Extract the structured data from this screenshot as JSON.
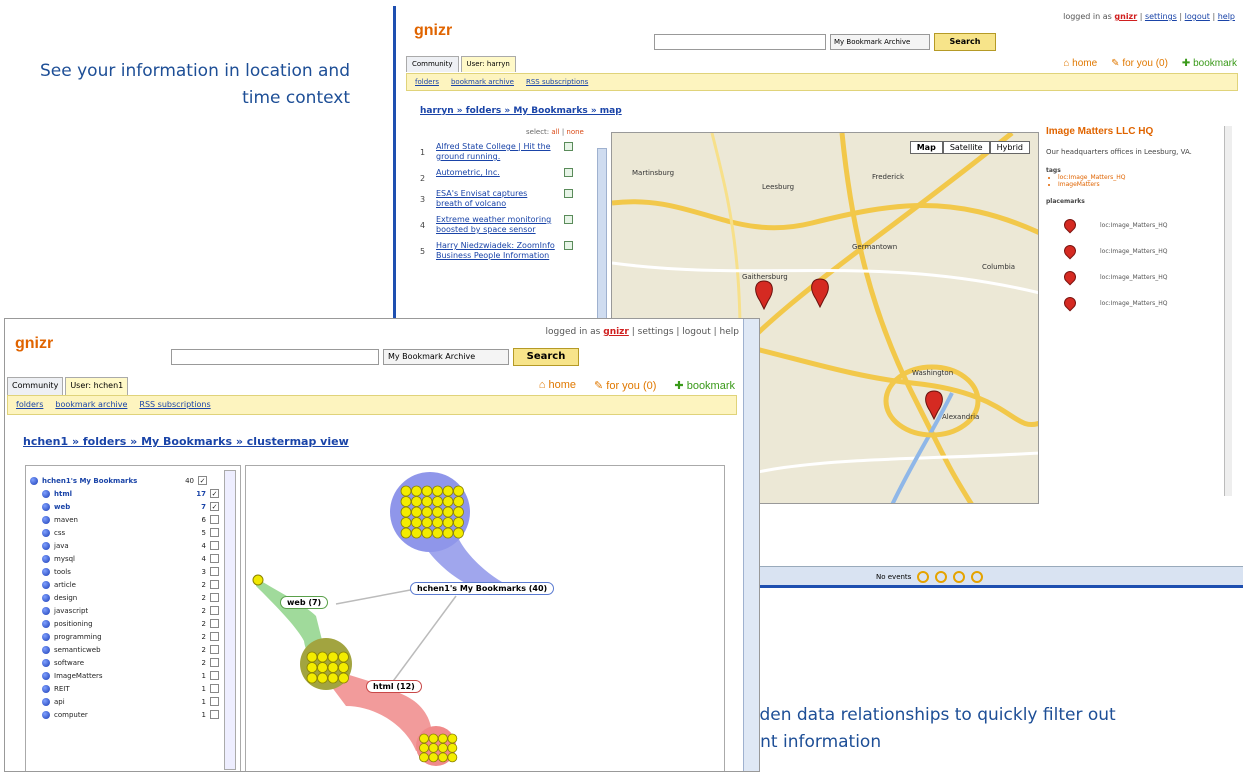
{
  "captions": {
    "top": "See your information in location and time context",
    "bottom": "Use hidden data relationships to quickly filter out irrelevant information"
  },
  "back_window": {
    "logo": "gnizr",
    "logged_in_prefix": "logged in as",
    "user": "gnizr",
    "top_links": [
      "settings",
      "logout",
      "help"
    ],
    "search_placeholder": "",
    "search_scope": "My Bookmark Archive",
    "search_button": "Search",
    "tabs": [
      "Community",
      "User: harryn"
    ],
    "quick_links": [
      "home",
      "for you (0)",
      "bookmark"
    ],
    "subnav": [
      "folders",
      "bookmark archive",
      "RSS subscriptions"
    ],
    "breadcrumb": "harryn » folders » My Bookmarks » map",
    "select_label": "select:",
    "select_all": "all",
    "select_none": "none",
    "bookmarks": [
      {
        "num": "1",
        "title": "Alfred State College | Hit the ground running."
      },
      {
        "num": "2",
        "title": "Autometric, Inc."
      },
      {
        "num": "3",
        "title": "ESA's Envisat captures breath of volcano"
      },
      {
        "num": "4",
        "title": "Extreme weather monitoring boosted by space sensor"
      },
      {
        "num": "5",
        "title": "Harry Niedzwiadek: ZoomInfo Business People Information"
      }
    ],
    "map_buttons": [
      "Map",
      "Satellite",
      "Hybrid"
    ],
    "map_places": [
      "Martinsburg",
      "Leesburg",
      "Gaithersburg",
      "Washington",
      "Alexandria",
      "Frederick",
      "Germantown",
      "Columbia"
    ],
    "info": {
      "title": "Image Matters LLC HQ",
      "description": "Our headquarters offices in Leesburg, VA.",
      "tags_label": "tags",
      "tags": [
        "loc:Image_Matters_HQ",
        "ImageMatters"
      ],
      "placemarks_label": "placemarks",
      "placemarks": [
        "loc:Image_Matters_HQ",
        "loc:Image_Matters_HQ",
        "loc:Image_Matters_HQ",
        "loc:Image_Matters_HQ"
      ]
    },
    "status_text": "No events"
  },
  "front_window": {
    "logo": "gnizr",
    "logged_in_prefix": "logged in as",
    "user": "gnizr",
    "top_links": [
      "settings",
      "logout",
      "help"
    ],
    "search_scope": "My Bookmark Archive",
    "search_button": "Search",
    "tabs": [
      "Community",
      "User: hchen1"
    ],
    "quick_links": [
      "home",
      "for you (0)",
      "bookmark"
    ],
    "subnav": [
      "folders",
      "bookmark archive",
      "RSS subscriptions"
    ],
    "breadcrumb": "hchen1 » folders » My Bookmarks » clustermap view",
    "tree": [
      {
        "name": "hchen1's My Bookmarks",
        "count": "40",
        "checked": true,
        "root": true
      },
      {
        "name": "html",
        "count": "17",
        "checked": true,
        "bold": true
      },
      {
        "name": "web",
        "count": "7",
        "checked": true,
        "bold": true
      },
      {
        "name": "maven",
        "count": "6",
        "checked": false
      },
      {
        "name": "css",
        "count": "5",
        "checked": false
      },
      {
        "name": "java",
        "count": "4",
        "checked": false
      },
      {
        "name": "mysql",
        "count": "4",
        "checked": false
      },
      {
        "name": "tools",
        "count": "3",
        "checked": false
      },
      {
        "name": "article",
        "count": "2",
        "checked": false
      },
      {
        "name": "design",
        "count": "2",
        "checked": false
      },
      {
        "name": "javascript",
        "count": "2",
        "checked": false
      },
      {
        "name": "positioning",
        "count": "2",
        "checked": false
      },
      {
        "name": "programming",
        "count": "2",
        "checked": false
      },
      {
        "name": "semanticweb",
        "count": "2",
        "checked": false
      },
      {
        "name": "software",
        "count": "2",
        "checked": false
      },
      {
        "name": "ImageMatters",
        "count": "1",
        "checked": false
      },
      {
        "name": "REIT",
        "count": "1",
        "checked": false
      },
      {
        "name": "api",
        "count": "1",
        "checked": false
      },
      {
        "name": "computer",
        "count": "1",
        "checked": false
      }
    ],
    "clusters": {
      "main": "hchen1's My Bookmarks (40)",
      "web": "web (7)",
      "html": "html (12)"
    }
  }
}
